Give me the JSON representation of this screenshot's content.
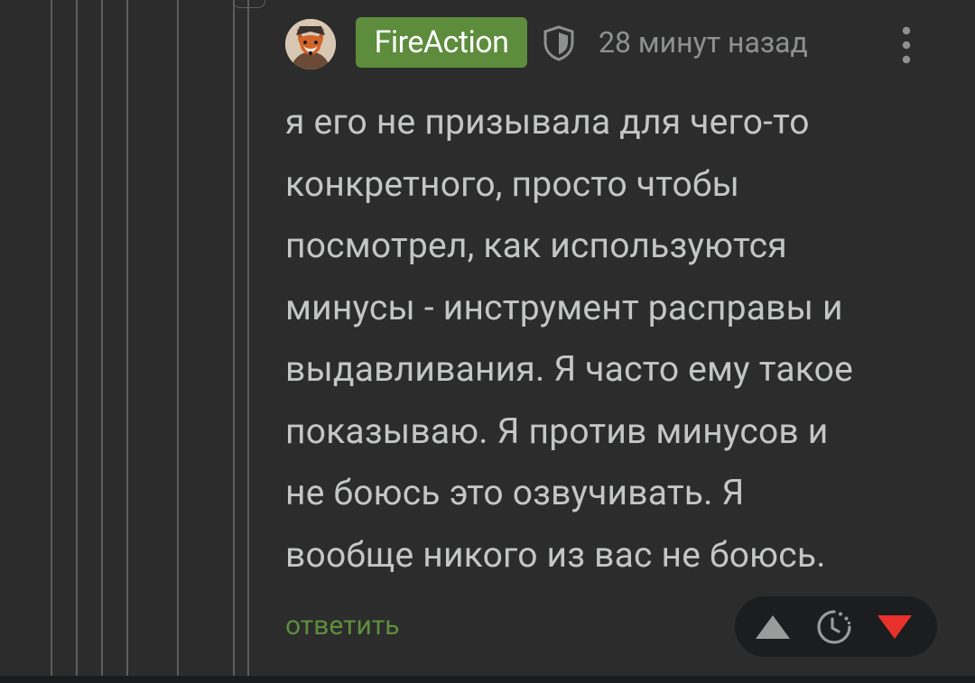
{
  "comment": {
    "author": "FireAction",
    "avatar_icon": "fox-avatar",
    "author_badge_color": "#5c8c3c",
    "timestamp": "28 минут назад",
    "text_lines": [
      "я его не призывала для чего-то",
      "конкретного, просто чтобы",
      "посмотрел, как используются",
      "минусы - инструмент расправы и",
      "выдавливания. Я часто ему такое",
      "показываю. Я против минусов и",
      "не боюсь это озвучивать. Я",
      "вообще никого из вас не боюсь."
    ],
    "reply_label": "ответить",
    "reply_color": "#5f8d3f",
    "downvote_color": "#e8312c"
  }
}
